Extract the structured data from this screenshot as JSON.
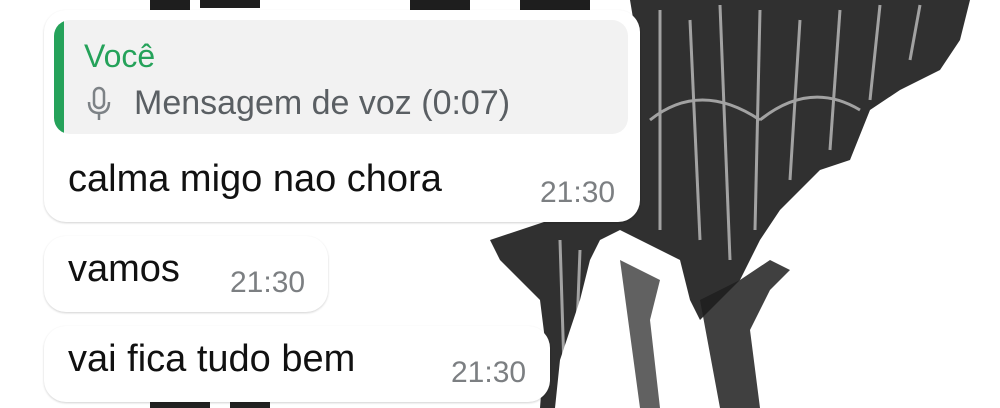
{
  "colors": {
    "accent_green": "#25a25a",
    "bubble_bg": "#ffffff",
    "quote_bg": "#f2f2f2",
    "time_text": "#7c7f82"
  },
  "reply": {
    "author": "Você",
    "icon": "microphone-icon",
    "text": "Mensagem de voz (0:07)"
  },
  "messages": [
    {
      "text": "calma migo nao chora",
      "time": "21:30"
    },
    {
      "text": "vamos",
      "time": "21:30"
    },
    {
      "text": "vai fica tudo bem",
      "time": "21:30"
    }
  ]
}
